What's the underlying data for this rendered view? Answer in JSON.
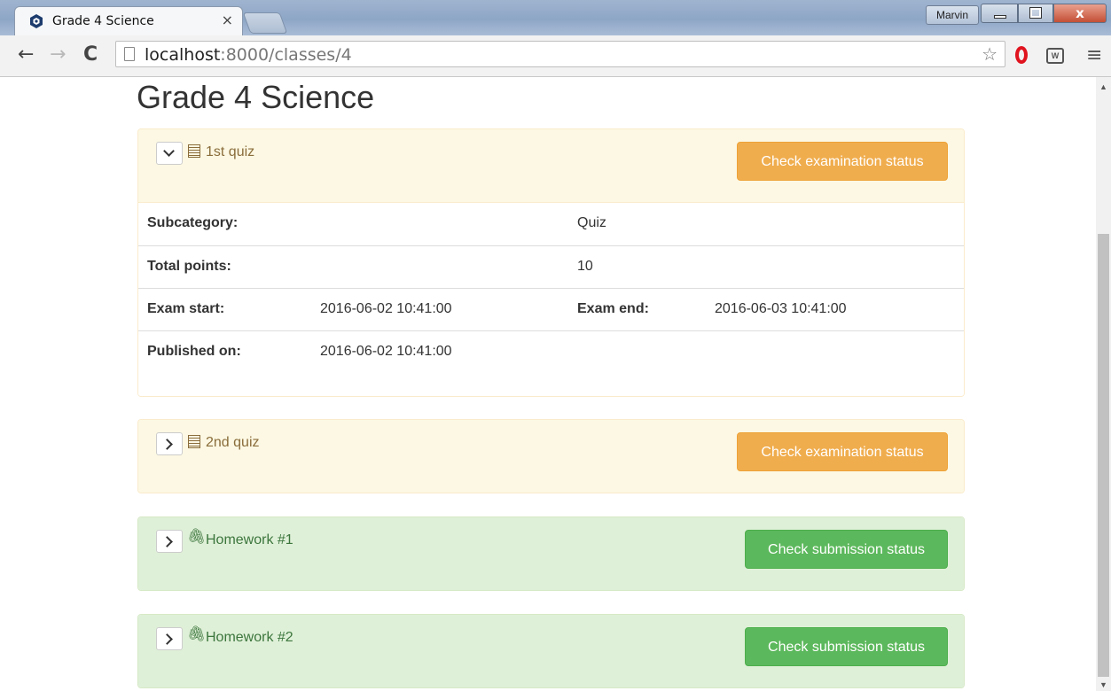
{
  "browser": {
    "tab_title": "Grade 4 Science",
    "tab_close": "×",
    "profile_name": "Marvin",
    "close_glyph": "x",
    "url_host": "localhost",
    "url_rest": ":8000/classes/4"
  },
  "page": {
    "title": "Grade 4 Science"
  },
  "items": [
    {
      "title": "1st quiz",
      "type": "quiz",
      "expanded": true,
      "button": "Check examination status",
      "details": {
        "subcategory_label": "Subcategory:",
        "subcategory": "Quiz",
        "total_points_label": "Total points:",
        "total_points": "10",
        "exam_start_label": "Exam start:",
        "exam_start": "2016-06-02 10:41:00",
        "exam_end_label": "Exam end:",
        "exam_end": "2016-06-03 10:41:00",
        "published_label": "Published on:",
        "published": "2016-06-02 10:41:00"
      }
    },
    {
      "title": "2nd quiz",
      "type": "quiz",
      "expanded": false,
      "button": "Check examination status"
    },
    {
      "title": "Homework #1",
      "type": "homework",
      "expanded": false,
      "button": "Check submission status"
    },
    {
      "title": "Homework #2",
      "type": "homework",
      "expanded": false,
      "button": "Check submission status"
    }
  ],
  "colors": {
    "warning_heading_bg": "#fcf8e3",
    "warning_button": "#f0ad4e",
    "success_heading_bg": "#dff0d8",
    "success_button": "#5cb85c"
  },
  "icons": {
    "quiz": "list-alt-icon",
    "homework": "paperclip-icon",
    "expanded": "chevron-down-icon",
    "collapsed": "chevron-right-icon"
  }
}
